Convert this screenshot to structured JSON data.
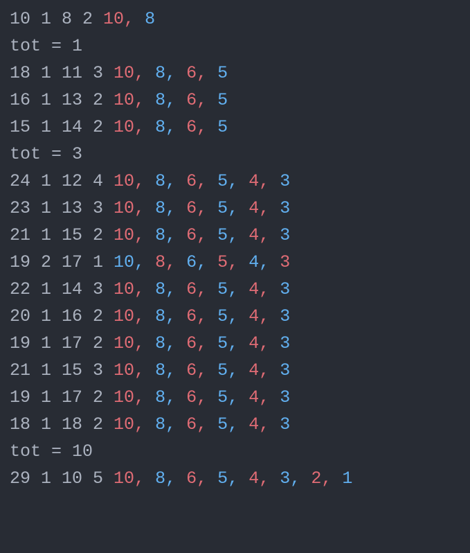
{
  "lines": [
    {
      "type": "data",
      "prefix": [
        "10",
        "1",
        "8",
        "2"
      ],
      "elems": [
        "10",
        "8"
      ]
    },
    {
      "type": "tot",
      "val": "1"
    },
    {
      "type": "data",
      "prefix": [
        "18",
        "1",
        "11",
        "3"
      ],
      "elems": [
        "10",
        "8",
        "6",
        "5"
      ]
    },
    {
      "type": "data",
      "prefix": [
        "16",
        "1",
        "13",
        "2"
      ],
      "elems": [
        "10",
        "8",
        "6",
        "5"
      ]
    },
    {
      "type": "data",
      "prefix": [
        "15",
        "1",
        "14",
        "2"
      ],
      "elems": [
        "10",
        "8",
        "6",
        "5"
      ]
    },
    {
      "type": "tot",
      "val": "3"
    },
    {
      "type": "data",
      "prefix": [
        "24",
        "1",
        "12",
        "4"
      ],
      "elems": [
        "10",
        "8",
        "6",
        "5",
        "4",
        "3"
      ]
    },
    {
      "type": "data",
      "prefix": [
        "23",
        "1",
        "13",
        "3"
      ],
      "elems": [
        "10",
        "8",
        "6",
        "5",
        "4",
        "3"
      ]
    },
    {
      "type": "data",
      "prefix": [
        "21",
        "1",
        "15",
        "2"
      ],
      "elems": [
        "10",
        "8",
        "6",
        "5",
        "4",
        "3"
      ]
    },
    {
      "type": "data",
      "prefix": [
        "19",
        "2",
        "17",
        "1"
      ],
      "elems": [
        "10",
        "8",
        "6",
        "5",
        "4",
        "3"
      ],
      "startColor": "b"
    },
    {
      "type": "data",
      "prefix": [
        "22",
        "1",
        "14",
        "3"
      ],
      "elems": [
        "10",
        "8",
        "6",
        "5",
        "4",
        "3"
      ]
    },
    {
      "type": "data",
      "prefix": [
        "20",
        "1",
        "16",
        "2"
      ],
      "elems": [
        "10",
        "8",
        "6",
        "5",
        "4",
        "3"
      ]
    },
    {
      "type": "data",
      "prefix": [
        "19",
        "1",
        "17",
        "2"
      ],
      "elems": [
        "10",
        "8",
        "6",
        "5",
        "4",
        "3"
      ]
    },
    {
      "type": "data",
      "prefix": [
        "21",
        "1",
        "15",
        "3"
      ],
      "elems": [
        "10",
        "8",
        "6",
        "5",
        "4",
        "3"
      ]
    },
    {
      "type": "data",
      "prefix": [
        "19",
        "1",
        "17",
        "2"
      ],
      "elems": [
        "10",
        "8",
        "6",
        "5",
        "4",
        "3"
      ]
    },
    {
      "type": "data",
      "prefix": [
        "18",
        "1",
        "18",
        "2"
      ],
      "elems": [
        "10",
        "8",
        "6",
        "5",
        "4",
        "3"
      ]
    },
    {
      "type": "tot",
      "val": "10"
    },
    {
      "type": "data",
      "prefix": [
        "29",
        "1",
        "10",
        "5"
      ],
      "elems": [
        "10",
        "8",
        "6",
        "5",
        "4",
        "3",
        "2",
        "1"
      ]
    }
  ],
  "totLabel": "tot",
  "eq": "="
}
